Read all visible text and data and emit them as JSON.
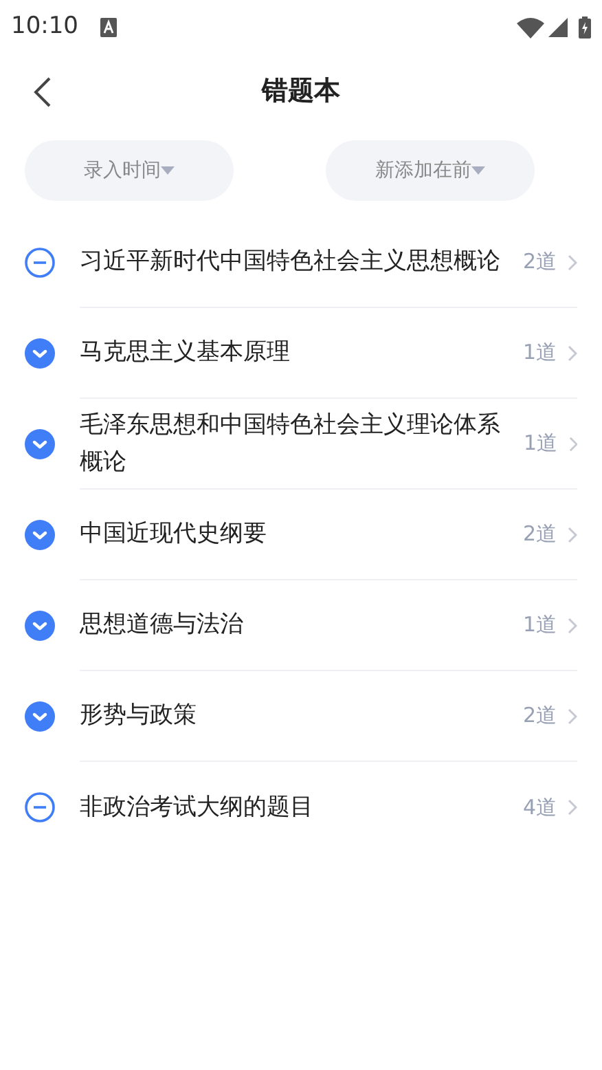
{
  "status_bar": {
    "time": "10:10"
  },
  "header": {
    "title": "错题本"
  },
  "filters": [
    {
      "label": "录入时间"
    },
    {
      "label": "新添加在前"
    }
  ],
  "subjects": [
    {
      "name": "习近平新时代中国特色社会主义思想概论",
      "count": "2道",
      "checked": false
    },
    {
      "name": "马克思主义基本原理",
      "count": "1道",
      "checked": true
    },
    {
      "name": "毛泽东思想和中国特色社会主义理论体系概论",
      "count": "1道",
      "checked": true
    },
    {
      "name": "中国近现代史纲要",
      "count": "2道",
      "checked": true
    },
    {
      "name": "思想道德与法治",
      "count": "1道",
      "checked": true
    },
    {
      "name": "形势与政策",
      "count": "2道",
      "checked": true
    },
    {
      "name": "非政治考试大纲的题目",
      "count": "4道",
      "checked": false
    }
  ]
}
